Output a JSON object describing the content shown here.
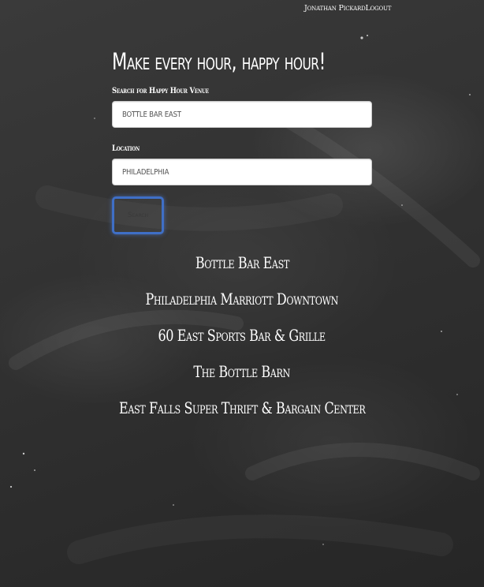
{
  "nav": {
    "user_name": "Jonathan Pickard",
    "logout_label": "Logout"
  },
  "page": {
    "title": "Make every hour, happy hour!"
  },
  "form": {
    "venue_label": "Search for Happy Hour Venue",
    "venue_value": "bottle bar east",
    "location_label": "Location",
    "location_value": "philadelphia",
    "search_button_label": "Search"
  },
  "results": [
    "Bottle Bar East",
    "Philadelphia Marriott Downtown",
    "60 East Sports Bar & Grille",
    "The Bottle Barn",
    "East Falls Super Thrift & Bargain Center"
  ],
  "colors": {
    "background": "#333333",
    "text": "#ffffff",
    "button_focus_border": "#3f6fc6"
  }
}
